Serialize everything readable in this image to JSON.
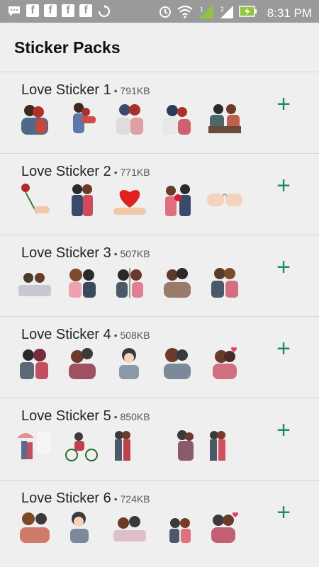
{
  "status_bar": {
    "time": "8:31 PM",
    "left_icons": [
      "chat-icon",
      "facebook-icon",
      "facebook-icon",
      "facebook-icon",
      "facebook-icon",
      "recycle-icon"
    ],
    "right_icons": [
      "alarm-icon",
      "wifi-icon",
      "signal-icon",
      "signal-2-icon",
      "battery-charging-icon"
    ]
  },
  "header": {
    "title": "Sticker Packs"
  },
  "packs": [
    {
      "name": "Love Sticker 1",
      "size": "• 791KB",
      "add_icon": "add-icon"
    },
    {
      "name": "Love Sticker 2",
      "size": "• 771KB",
      "add_icon": "add-icon"
    },
    {
      "name": "Love Sticker 3",
      "size": "• 507KB",
      "add_icon": "add-icon"
    },
    {
      "name": "Love Sticker 4",
      "size": "• 508KB",
      "add_icon": "add-icon"
    },
    {
      "name": "Love Sticker 5",
      "size": "• 850KB",
      "add_icon": "add-icon"
    },
    {
      "name": "Love Sticker 6",
      "size": "• 724KB",
      "add_icon": "add-icon"
    }
  ],
  "colors": {
    "accent": "#1f8a70",
    "background": "#efefef",
    "status_bar": "#9a9a9a"
  }
}
